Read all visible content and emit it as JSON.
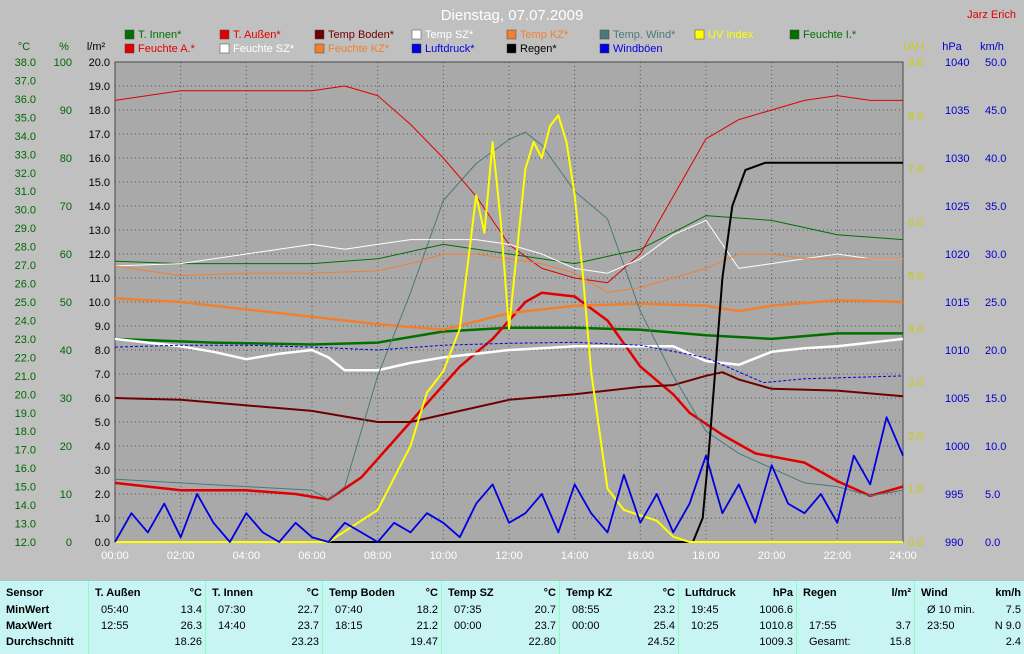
{
  "chart_data": {
    "type": "line",
    "title": "Dienstag, 07.07.2009",
    "watermark": "Jarz Erich",
    "x_ticks": [
      "00:00",
      "02:00",
      "04:00",
      "06:00",
      "08:00",
      "10:00",
      "12:00",
      "14:00",
      "16:00",
      "18:00",
      "20:00",
      "22:00",
      "24:00"
    ],
    "x_range_hours": [
      0,
      24
    ],
    "axes": [
      {
        "id": "temp",
        "unit": "°C",
        "color": "#006600",
        "min": 12,
        "max": 38,
        "ticks": [
          "12.0",
          "13.0",
          "14.0",
          "15.0",
          "16.0",
          "17.0",
          "18.0",
          "19.0",
          "20.0",
          "21.0",
          "22.0",
          "23.0",
          "24.0",
          "25.0",
          "26.0",
          "27.0",
          "28.0",
          "29.0",
          "30.0",
          "31.0",
          "32.0",
          "33.0",
          "34.0",
          "35.0",
          "36.0",
          "37.0",
          "38.0"
        ]
      },
      {
        "id": "hum",
        "unit": "%",
        "color": "#006600",
        "min": 0,
        "max": 100,
        "ticks": [
          "0",
          "10",
          "20",
          "30",
          "40",
          "50",
          "60",
          "70",
          "80",
          "90",
          "100"
        ]
      },
      {
        "id": "rain",
        "unit": "l/m²",
        "color": "#000000",
        "min": 0,
        "max": 20,
        "ticks": [
          "0.0",
          "1.0",
          "2.0",
          "3.0",
          "4.0",
          "5.0",
          "6.0",
          "7.0",
          "8.0",
          "9.0",
          "10.0",
          "11.0",
          "12.0",
          "13.0",
          "14.0",
          "15.0",
          "16.0",
          "17.0",
          "18.0",
          "19.0",
          "20.0"
        ]
      },
      {
        "id": "uv",
        "unit": "UV-I",
        "color": "#cccc00",
        "min": 0,
        "max": 9,
        "ticks": [
          "0.0",
          "1.0",
          "2.0",
          "3.0",
          "4.0",
          "5.0",
          "6.0",
          "7.0",
          "8.0",
          "9.0"
        ]
      },
      {
        "id": "press",
        "unit": "hPa",
        "color": "#0000cc",
        "min": 990,
        "max": 1040,
        "ticks": [
          "990",
          "995",
          "1000",
          "1005",
          "1010",
          "1015",
          "1020",
          "1025",
          "1030",
          "1035",
          "1040"
        ]
      },
      {
        "id": "wind",
        "unit": "km/h",
        "color": "#0000cc",
        "min": 0,
        "max": 50,
        "ticks": [
          "0.0",
          "5.0",
          "10.0",
          "15.0",
          "20.0",
          "25.0",
          "30.0",
          "35.0",
          "40.0",
          "45.0",
          "50.0"
        ]
      }
    ],
    "legend": [
      {
        "name": "T. Innen*",
        "color": "#007000"
      },
      {
        "name": "T. Außen*",
        "color": "#e00000"
      },
      {
        "name": "Temp Boden*",
        "color": "#700000"
      },
      {
        "name": "Temp SZ*",
        "color": "#ffffff"
      },
      {
        "name": "Temp KZ*",
        "color": "#f08030"
      },
      {
        "name": "Temp. Wind*",
        "color": "#4a7a7a"
      },
      {
        "name": "UV Index",
        "color": "#ffff00"
      },
      {
        "name": "Feuchte I.*",
        "color": "#007000"
      },
      {
        "name": "Feuchte A.*",
        "color": "#e00000"
      },
      {
        "name": "Feuchte SZ*",
        "color": "#ffffff"
      },
      {
        "name": "Feuchte KZ*",
        "color": "#f08030"
      },
      {
        "name": "Luftdruck*",
        "color": "#0000e0"
      },
      {
        "name": "Regen*",
        "color": "#000000"
      },
      {
        "name": "Windböen",
        "color": "#0000e0"
      }
    ],
    "series": [
      {
        "name": "T. Innen*",
        "axis": "temp",
        "color": "#007000",
        "width": 2.5,
        "x": [
          0,
          3,
          6,
          8,
          10,
          12,
          14,
          16,
          18,
          20,
          22,
          24
        ],
        "y": [
          23.0,
          22.8,
          22.7,
          22.8,
          23.4,
          23.6,
          23.6,
          23.5,
          23.2,
          23.0,
          23.3,
          23.3
        ]
      },
      {
        "name": "T. Außen*",
        "axis": "temp",
        "color": "#e00000",
        "width": 2.5,
        "x": [
          0,
          2,
          4,
          5.5,
          6.5,
          7.5,
          8.5,
          9.5,
          10.5,
          11.5,
          12.5,
          13,
          14,
          15,
          16,
          17,
          17.5,
          18.5,
          19.5,
          21,
          22,
          23,
          24
        ],
        "y": [
          15.2,
          14.8,
          14.8,
          14.6,
          14.3,
          15.5,
          17.5,
          19.5,
          21.5,
          23.0,
          25.0,
          25.5,
          25.3,
          24.0,
          21.5,
          20.0,
          19.0,
          17.8,
          16.8,
          16.3,
          15.3,
          14.5,
          15.0
        ]
      },
      {
        "name": "Temp Boden*",
        "axis": "temp",
        "color": "#700000",
        "width": 2,
        "x": [
          0,
          2,
          4,
          6,
          7,
          8,
          9,
          10,
          12,
          14,
          16,
          17,
          18,
          18.5,
          19,
          20,
          22,
          24
        ],
        "y": [
          19.8,
          19.7,
          19.4,
          19.1,
          18.8,
          18.5,
          18.5,
          18.9,
          19.7,
          20.0,
          20.4,
          20.5,
          21.0,
          21.2,
          20.8,
          20.3,
          20.2,
          19.9
        ]
      },
      {
        "name": "Temp SZ*",
        "axis": "temp",
        "color": "#ffffff",
        "width": 2.5,
        "x": [
          0,
          1,
          2,
          3,
          4,
          5,
          6,
          6.5,
          7,
          8,
          9,
          10,
          11,
          12,
          13,
          14,
          15,
          16,
          17,
          18,
          19,
          20,
          21,
          22,
          23,
          24
        ],
        "y": [
          23.0,
          22.8,
          22.6,
          22.3,
          21.9,
          22.2,
          22.4,
          22.0,
          21.3,
          21.3,
          21.7,
          22.0,
          22.2,
          22.4,
          22.5,
          22.6,
          22.6,
          22.6,
          22.6,
          21.8,
          21.6,
          22.3,
          22.5,
          22.6,
          22.8,
          23.0
        ]
      },
      {
        "name": "Temp KZ*",
        "axis": "temp",
        "color": "#f08030",
        "width": 2.5,
        "x": [
          0,
          2,
          4,
          6,
          8,
          10,
          12,
          14,
          16,
          18,
          19,
          20,
          22,
          24
        ],
        "y": [
          25.2,
          25.0,
          24.6,
          24.2,
          23.8,
          23.5,
          24.4,
          24.8,
          24.9,
          24.8,
          24.5,
          24.8,
          25.1,
          25.0
        ]
      },
      {
        "name": "Temp. Wind*",
        "axis": "temp",
        "color": "#4a7a7a",
        "width": 1,
        "x": [
          0,
          2,
          4,
          6,
          6.5,
          7,
          8,
          9,
          10,
          11,
          12,
          12.5,
          13,
          14,
          15,
          16,
          17,
          18,
          19,
          20,
          21,
          22,
          23,
          24
        ],
        "y": [
          15.4,
          15.2,
          15.0,
          14.8,
          14.3,
          15.0,
          21.0,
          25.5,
          30.5,
          32.5,
          33.8,
          34.2,
          33.5,
          31.0,
          29.5,
          24.5,
          21.0,
          18.0,
          16.8,
          16.0,
          15.2,
          15.0,
          14.5,
          14.8
        ]
      },
      {
        "name": "Feuchte I.*",
        "axis": "hum",
        "color": "#007000",
        "width": 1,
        "x": [
          0,
          2,
          4,
          6,
          8,
          10,
          12,
          14,
          16,
          18,
          20,
          22,
          24
        ],
        "y": [
          58.5,
          58.0,
          58.0,
          58.0,
          59.0,
          62.0,
          60.0,
          58.0,
          61.0,
          68.0,
          67.0,
          64.0,
          63.0
        ]
      },
      {
        "name": "Feuchte A.*",
        "axis": "hum",
        "color": "#e00000",
        "width": 1,
        "x": [
          0,
          2,
          4,
          6,
          7,
          8,
          9,
          10,
          11,
          12,
          13,
          14,
          15,
          16,
          17,
          18,
          19,
          20,
          21,
          22,
          23,
          24
        ],
        "y": [
          92,
          94,
          94,
          94,
          95,
          93,
          87,
          80,
          72,
          62,
          57,
          55,
          54,
          60,
          72,
          84,
          88,
          90,
          92,
          93,
          92,
          92
        ]
      },
      {
        "name": "Feuchte SZ*",
        "axis": "hum",
        "color": "#ffffff",
        "width": 1,
        "x": [
          0,
          2,
          4,
          6,
          7,
          8,
          9,
          10,
          11,
          12,
          13,
          14,
          15,
          16,
          17,
          18,
          19,
          20,
          21,
          22,
          23,
          24
        ],
        "y": [
          57.5,
          58,
          60,
          62,
          61,
          62,
          63,
          63,
          63,
          62,
          60,
          57,
          56,
          59,
          64,
          67,
          57,
          58,
          59,
          60,
          59,
          59
        ]
      },
      {
        "name": "Feuchte KZ*",
        "axis": "hum",
        "color": "#f08030",
        "width": 1,
        "x": [
          0,
          2,
          4,
          6,
          8,
          9,
          10,
          11,
          12,
          13,
          14,
          15,
          16,
          17,
          18,
          19,
          20,
          21,
          22,
          23,
          24
        ],
        "y": [
          57.5,
          55.5,
          56,
          56,
          56.5,
          58,
          60,
          60,
          59,
          58,
          56,
          52,
          53,
          55,
          57,
          60,
          60,
          59,
          59,
          59,
          59
        ]
      },
      {
        "name": "Luftdruck*",
        "axis": "press",
        "color": "#0000e0",
        "width": 1,
        "dashed": true,
        "x": [
          0,
          2,
          4,
          6,
          8,
          10,
          12,
          14,
          16,
          18,
          19.75,
          21,
          24
        ],
        "y": [
          1010.3,
          1010.5,
          1010.5,
          1010.3,
          1010.0,
          1010.5,
          1010.7,
          1010.8,
          1010.5,
          1009.2,
          1006.6,
          1007.0,
          1007.3
        ]
      },
      {
        "name": "Regen*",
        "axis": "rain",
        "color": "#000000",
        "width": 2,
        "x": [
          0,
          17.6,
          17.9,
          18.1,
          18.3,
          18.5,
          18.8,
          19.2,
          19.8,
          24
        ],
        "y": [
          0,
          0,
          1.0,
          4.0,
          7.5,
          11.0,
          14.0,
          15.5,
          15.8,
          15.8
        ]
      },
      {
        "name": "UV Index",
        "axis": "uv",
        "color": "#ffff00",
        "width": 2,
        "x": [
          0,
          6.5,
          7,
          8,
          9,
          9.5,
          10,
          10.5,
          11,
          11.25,
          11.5,
          11.75,
          12,
          12.25,
          12.5,
          12.75,
          13,
          13.25,
          13.5,
          13.75,
          14,
          14.25,
          14.5,
          15,
          15.5,
          16,
          16.5,
          17,
          17.5,
          18,
          24
        ],
        "y": [
          0,
          0,
          0.2,
          0.6,
          1.8,
          2.8,
          3.2,
          4.0,
          6.5,
          5.8,
          7.5,
          6.0,
          4.0,
          5.5,
          7.0,
          7.5,
          7.2,
          7.8,
          8.0,
          7.5,
          6.5,
          5.0,
          3.2,
          1.0,
          0.6,
          0.5,
          0.4,
          0.1,
          0,
          0,
          0
        ]
      },
      {
        "name": "Windböen",
        "axis": "wind",
        "color": "#0000e0",
        "width": 1.8,
        "x": [
          0,
          0.5,
          1,
          1.5,
          2,
          2.5,
          3,
          3.5,
          4,
          4.5,
          5,
          5.5,
          6,
          6.5,
          7,
          7.5,
          8,
          8.5,
          9,
          9.5,
          10,
          10.5,
          11,
          11.5,
          12,
          12.5,
          13,
          13.5,
          14,
          14.5,
          15,
          15.5,
          16,
          16.5,
          17,
          17.5,
          18,
          18.5,
          19,
          19.5,
          20,
          20.5,
          21,
          21.5,
          22,
          22.5,
          23,
          23.5,
          24
        ],
        "y": [
          0,
          3,
          1,
          4,
          0.5,
          5,
          2,
          0,
          3,
          1,
          0,
          2,
          0.5,
          0,
          2,
          1,
          0,
          2,
          1,
          3,
          2,
          0.5,
          4,
          6,
          2,
          3,
          5,
          1,
          6,
          3,
          1,
          7,
          2,
          5,
          1,
          4,
          9,
          3,
          6,
          2,
          8,
          4,
          3,
          5,
          2,
          9,
          6,
          13,
          9
        ]
      }
    ]
  },
  "table": {
    "row_labels": [
      "Sensor",
      "MinWert",
      "MaxWert",
      "Durchschnitt"
    ],
    "groups": [
      {
        "name": "T. Außen",
        "unit": "°C",
        "rows": [
          [
            "05:40",
            "13.4"
          ],
          [
            "12:55",
            "26.3"
          ],
          [
            "",
            "18.26"
          ]
        ]
      },
      {
        "name": "T. Innen",
        "unit": "°C",
        "rows": [
          [
            "07:30",
            "22.7"
          ],
          [
            "14:40",
            "23.7"
          ],
          [
            "",
            "23.23"
          ]
        ]
      },
      {
        "name": "Temp Boden",
        "unit": "°C",
        "rows": [
          [
            "07:40",
            "18.2"
          ],
          [
            "18:15",
            "21.2"
          ],
          [
            "",
            "19.47"
          ]
        ]
      },
      {
        "name": "Temp SZ",
        "unit": "°C",
        "rows": [
          [
            "07:35",
            "20.7"
          ],
          [
            "00:00",
            "23.7"
          ],
          [
            "",
            "22.80"
          ]
        ]
      },
      {
        "name": "Temp KZ",
        "unit": "°C",
        "rows": [
          [
            "08:55",
            "23.2"
          ],
          [
            "00:00",
            "25.4"
          ],
          [
            "",
            "24.52"
          ]
        ]
      },
      {
        "name": "Luftdruck",
        "unit": "hPa",
        "rows": [
          [
            "19:45",
            "1006.6"
          ],
          [
            "10:25",
            "1010.8"
          ],
          [
            "",
            "1009.3"
          ]
        ]
      },
      {
        "name": "Regen",
        "unit": "l/m²",
        "rows": [
          [
            "",
            ""
          ],
          [
            "17:55",
            "3.7"
          ],
          [
            "Gesamt:",
            "15.8"
          ]
        ]
      },
      {
        "name": "Wind",
        "unit": "km/h",
        "rows": [
          [
            "Ø 10 min.",
            "7.5"
          ],
          [
            "23:50",
            "N 9.0"
          ],
          [
            "",
            "2.4"
          ]
        ]
      }
    ]
  }
}
